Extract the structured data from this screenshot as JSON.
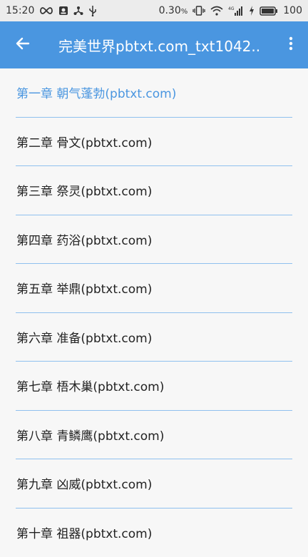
{
  "status_bar": {
    "time": "15:20",
    "speed": "0.30",
    "speed_unit": "%",
    "signal_tag": "4G",
    "battery": "100"
  },
  "app_bar": {
    "title": "完美世界pbtxt.com_txt1042.."
  },
  "chapters": [
    {
      "label": "第一章 朝气蓬勃(pbtxt.com)",
      "current": true
    },
    {
      "label": "第二章 骨文(pbtxt.com)"
    },
    {
      "label": "第三章 祭灵(pbtxt.com)"
    },
    {
      "label": "第四章 药浴(pbtxt.com)"
    },
    {
      "label": "第五章 举鼎(pbtxt.com)"
    },
    {
      "label": "第六章 准备(pbtxt.com)"
    },
    {
      "label": "第七章 梧木巢(pbtxt.com)"
    },
    {
      "label": "第八章 青鳞鹰(pbtxt.com)"
    },
    {
      "label": "第九章 凶威(pbtxt.com)"
    },
    {
      "label": "第十章 祖器(pbtxt.com)"
    }
  ],
  "colors": {
    "accent": "#4a96e0",
    "divider": "#8fc0ee",
    "background": "#f7f7f7"
  }
}
